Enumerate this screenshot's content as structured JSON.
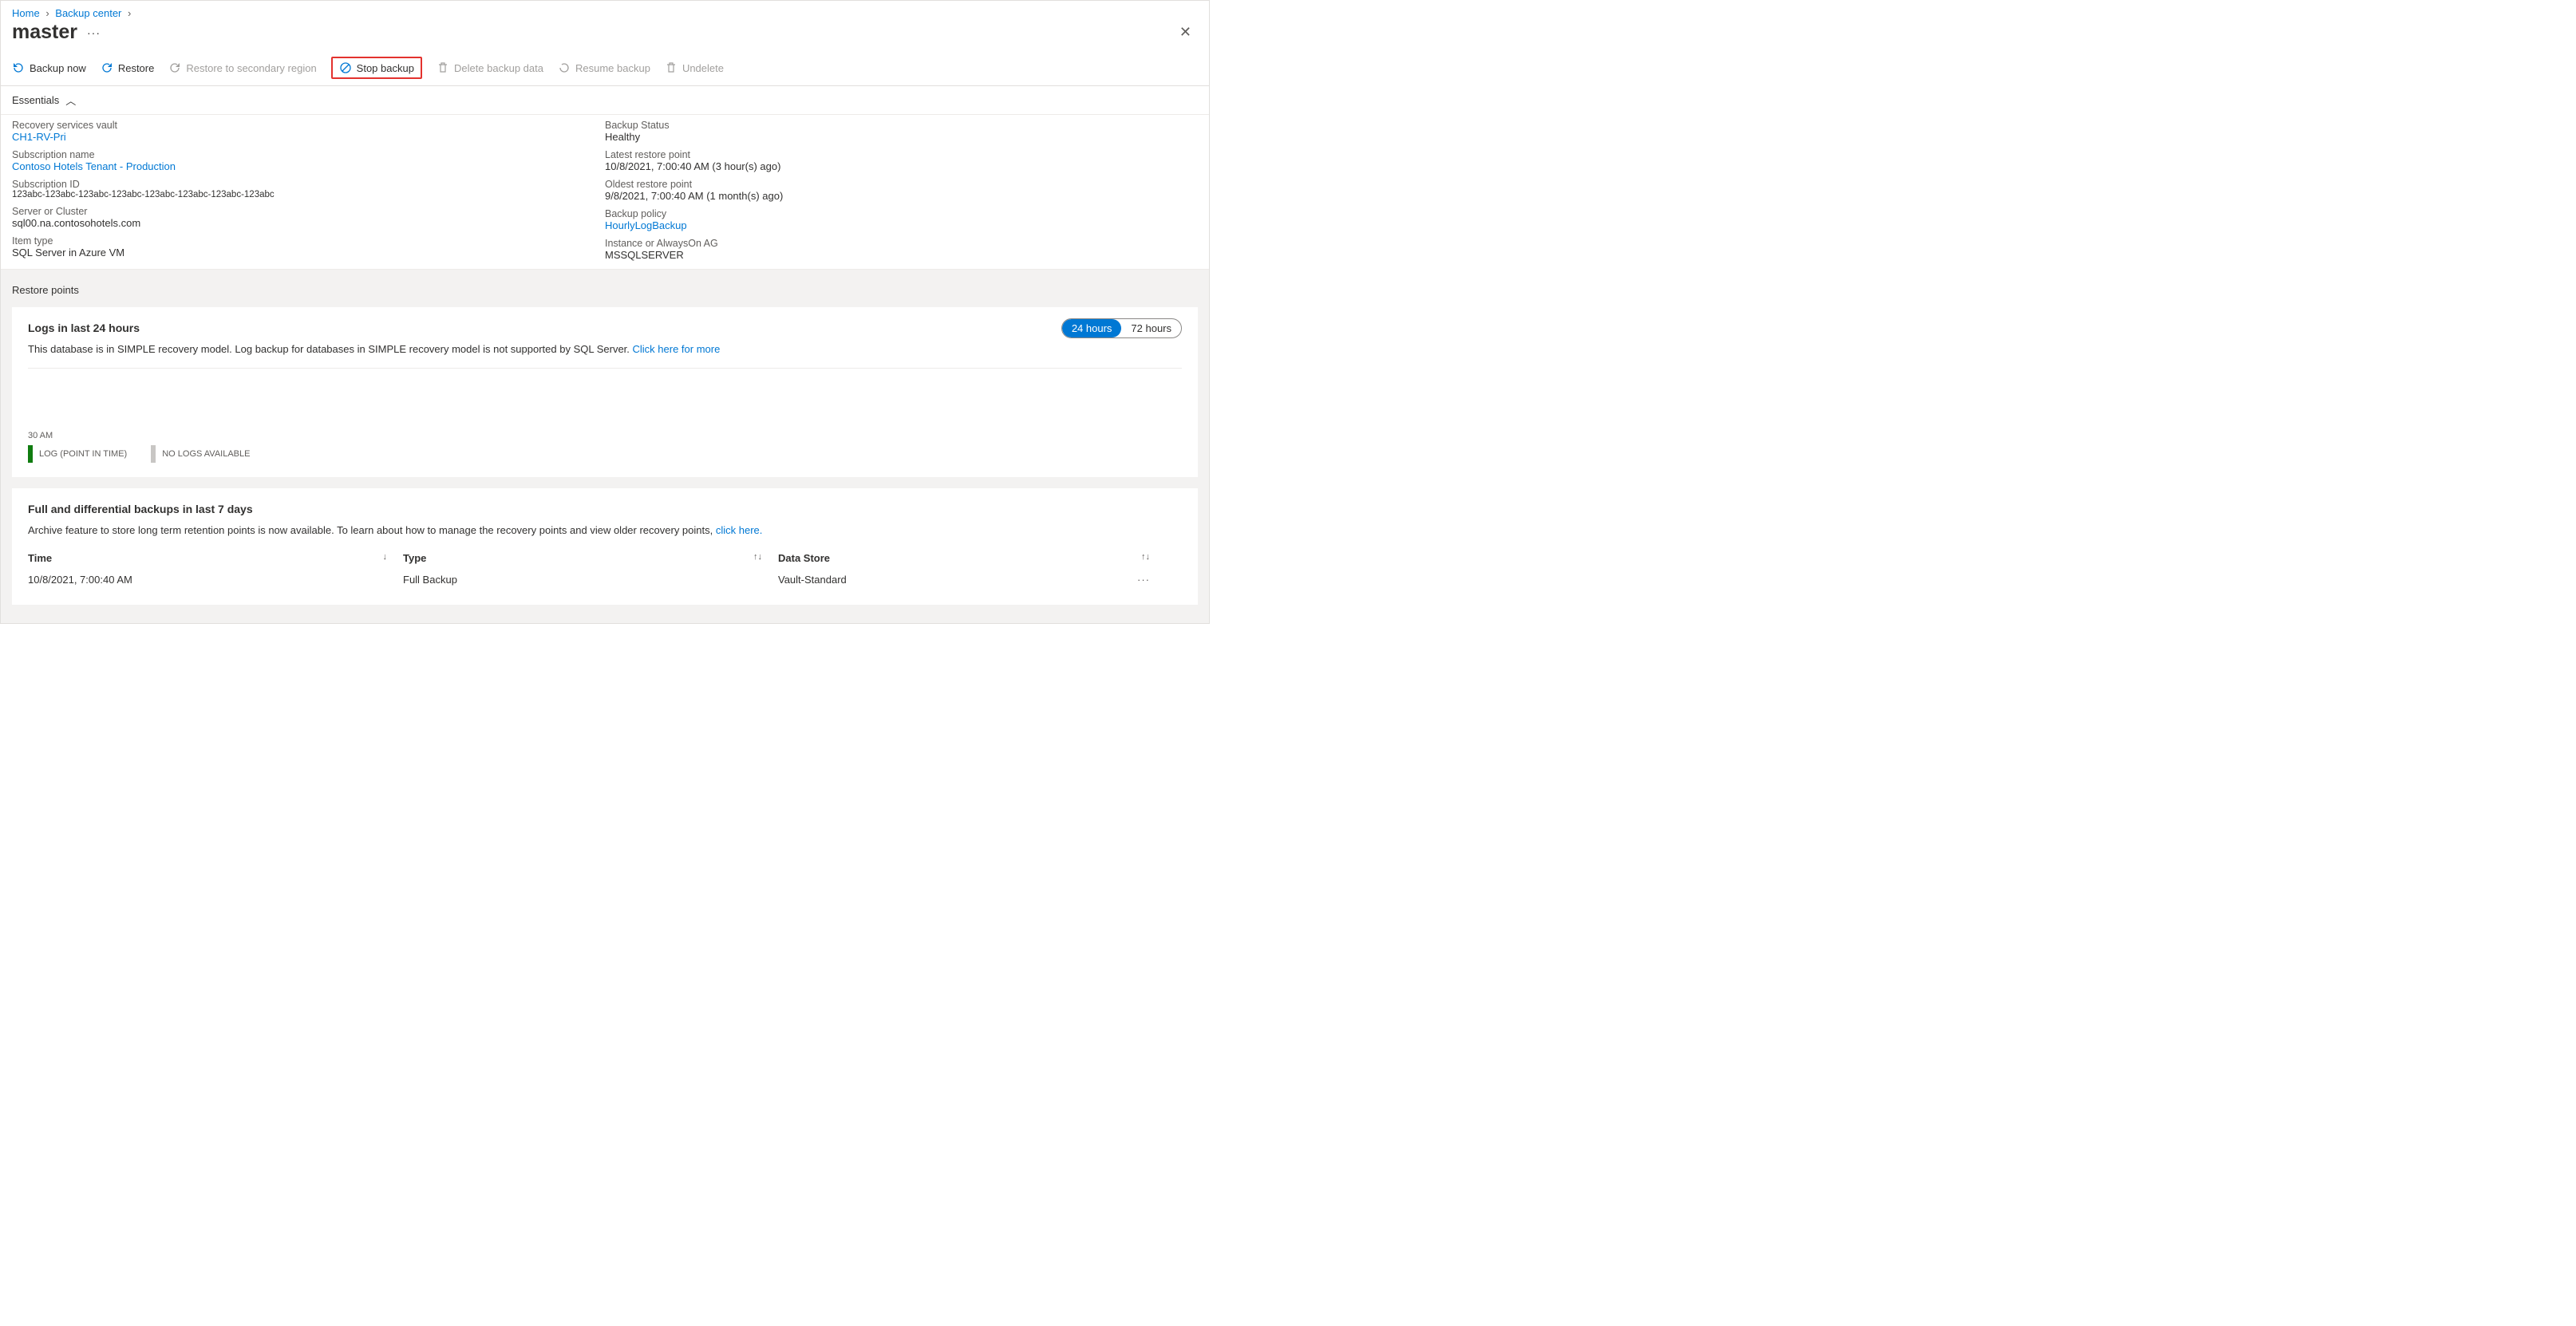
{
  "breadcrumb": {
    "home": "Home",
    "backup_center": "Backup center"
  },
  "title": "master",
  "toolbar": {
    "backup_now": "Backup now",
    "restore": "Restore",
    "restore_secondary": "Restore to secondary region",
    "stop_backup": "Stop backup",
    "delete_backup": "Delete backup data",
    "resume_backup": "Resume backup",
    "undelete": "Undelete"
  },
  "essentials_label": "Essentials",
  "essentials": {
    "left": {
      "rsv_label": "Recovery services vault",
      "rsv_val": "CH1-RV-Pri",
      "sub_name_label": "Subscription name",
      "sub_name_val": "Contoso Hotels Tenant - Production",
      "sub_id_label": "Subscription ID",
      "sub_id_val": "123abc-123abc-123abc-123abc-123abc-123abc-123abc-123abc",
      "server_label": "Server or Cluster",
      "server_val": "sql00.na.contosohotels.com",
      "item_type_label": "Item type",
      "item_type_val": "SQL Server in Azure VM"
    },
    "right": {
      "status_label": "Backup Status",
      "status_val": "Healthy",
      "latest_label": "Latest restore point",
      "latest_val": "10/8/2021, 7:00:40 AM (3 hour(s) ago)",
      "oldest_label": "Oldest restore point",
      "oldest_val": "9/8/2021, 7:00:40 AM (1 month(s) ago)",
      "policy_label": "Backup policy",
      "policy_val": "HourlyLogBackup",
      "instance_label": "Instance or AlwaysOn AG",
      "instance_val": "MSSQLSERVER"
    }
  },
  "restore_points_header": "Restore points",
  "logs_card": {
    "title": "Logs in last 24 hours",
    "desc": "This database is in SIMPLE recovery model. Log backup for databases in SIMPLE recovery model is not supported by SQL Server. ",
    "link": "Click here for more",
    "timeline_tick": "30 AM",
    "legend_log": "LOG (POINT IN TIME)",
    "legend_nolog": "NO LOGS AVAILABLE",
    "pill_24": "24 hours",
    "pill_72": "72 hours"
  },
  "backups_card": {
    "title": "Full and differential backups in last 7 days",
    "desc": "Archive feature to store long term retention points is now available. To learn about how to manage the recovery points and view older recovery points, ",
    "link": "click here.",
    "columns": {
      "time": "Time",
      "type": "Type",
      "datastore": "Data Store"
    },
    "rows": [
      {
        "time": "10/8/2021, 7:00:40 AM",
        "type": "Full Backup",
        "datastore": "Vault-Standard"
      }
    ]
  }
}
